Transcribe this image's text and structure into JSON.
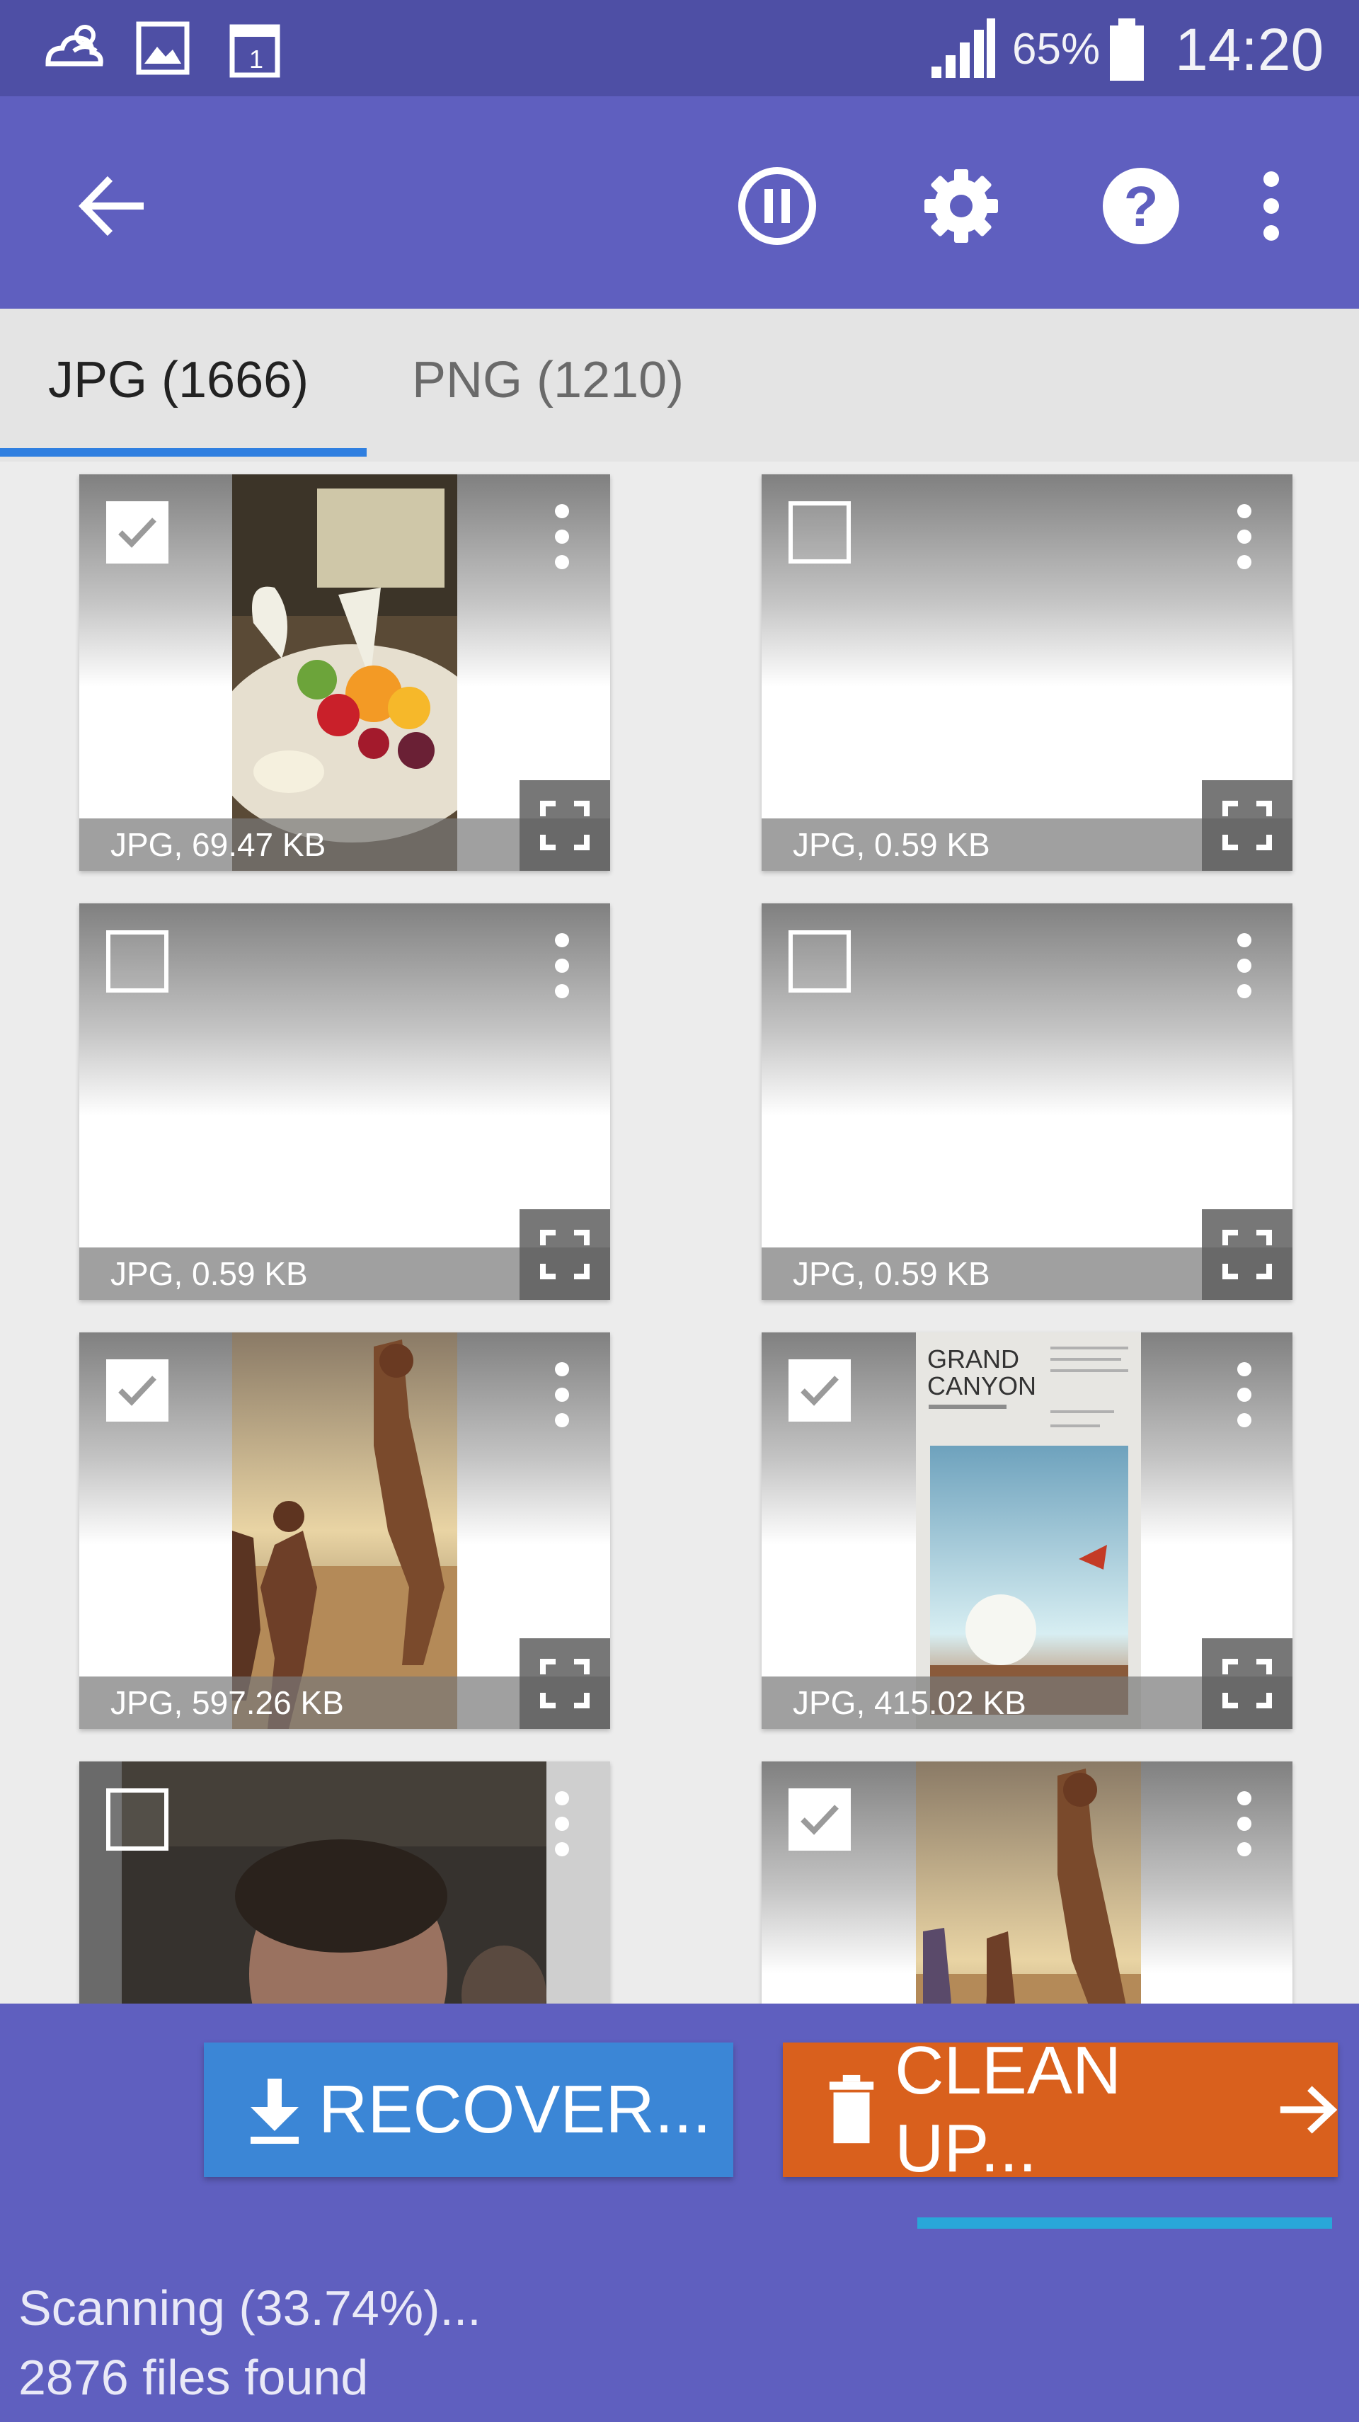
{
  "status_bar": {
    "battery_percent": "65%",
    "time": "14:20",
    "icons": [
      "cloud-person-icon",
      "image-icon",
      "calendar-icon",
      "signal-icon",
      "battery-icon"
    ]
  },
  "app_bar": {
    "icons": [
      "back-arrow-icon",
      "pause-icon",
      "gear-icon",
      "help-icon",
      "more-vert-icon"
    ]
  },
  "tabs": [
    {
      "label": "JPG (1666)",
      "active": true
    },
    {
      "label": "PNG (1210)",
      "active": false
    }
  ],
  "files": [
    {
      "label": "JPG, 69.47 KB",
      "checked": true,
      "photo": "cake"
    },
    {
      "label": "JPG, 0.59 KB",
      "checked": false,
      "photo": "none"
    },
    {
      "label": "JPG, 0.59 KB",
      "checked": false,
      "photo": "none"
    },
    {
      "label": "JPG, 0.59 KB",
      "checked": false,
      "photo": "none"
    },
    {
      "label": "JPG, 597.26 KB",
      "checked": true,
      "photo": "beach"
    },
    {
      "label": "JPG, 415.02 KB",
      "checked": true,
      "photo": "canyon"
    },
    {
      "label": "",
      "checked": false,
      "photo": "portrait"
    },
    {
      "label": "",
      "checked": true,
      "photo": "beach"
    }
  ],
  "canyon_cover": {
    "line1": "GRAND",
    "line2": "CANYON"
  },
  "buttons": {
    "recover": "RECOVER...",
    "clean_up": "CLEAN UP..."
  },
  "scan": {
    "progress_percent": 33.74,
    "status": "Scanning (33.74%)...",
    "files_found": "2876 files found"
  },
  "colors": {
    "app_bar": "#5f5fbf",
    "recover_button": "#3b86d6",
    "clean_button": "#d9601d",
    "tab_indicator": "#2f7fe0"
  }
}
